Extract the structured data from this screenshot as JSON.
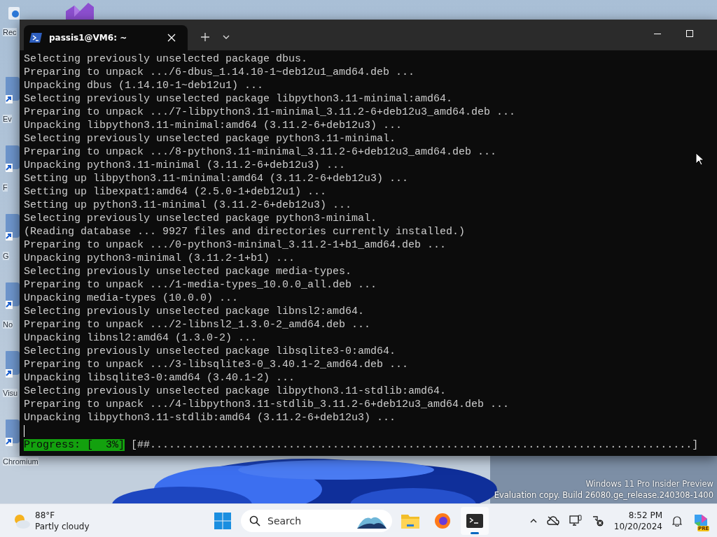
{
  "desktop_icons": [
    {
      "label": "Rec"
    },
    {
      "label": "Ev"
    },
    {
      "label": "F"
    },
    {
      "label": "G"
    },
    {
      "label": "No"
    },
    {
      "label": "Visu"
    },
    {
      "label": "Chromium"
    }
  ],
  "window": {
    "tab_title": "passis1@VM6: ~",
    "lines": [
      "Selecting previously unselected package dbus.",
      "Preparing to unpack .../6-dbus_1.14.10-1~deb12u1_amd64.deb ...",
      "Unpacking dbus (1.14.10-1~deb12u1) ...",
      "Selecting previously unselected package libpython3.11-minimal:amd64.",
      "Preparing to unpack .../7-libpython3.11-minimal_3.11.2-6+deb12u3_amd64.deb ...",
      "Unpacking libpython3.11-minimal:amd64 (3.11.2-6+deb12u3) ...",
      "Selecting previously unselected package python3.11-minimal.",
      "Preparing to unpack .../8-python3.11-minimal_3.11.2-6+deb12u3_amd64.deb ...",
      "Unpacking python3.11-minimal (3.11.2-6+deb12u3) ...",
      "Setting up libpython3.11-minimal:amd64 (3.11.2-6+deb12u3) ...",
      "Setting up libexpat1:amd64 (2.5.0-1+deb12u1) ...",
      "Setting up python3.11-minimal (3.11.2-6+deb12u3) ...",
      "Selecting previously unselected package python3-minimal.",
      "(Reading database ... 9927 files and directories currently installed.)",
      "Preparing to unpack .../0-python3-minimal_3.11.2-1+b1_amd64.deb ...",
      "Unpacking python3-minimal (3.11.2-1+b1) ...",
      "Selecting previously unselected package media-types.",
      "Preparing to unpack .../1-media-types_10.0.0_all.deb ...",
      "Unpacking media-types (10.0.0) ...",
      "Selecting previously unselected package libnsl2:amd64.",
      "Preparing to unpack .../2-libnsl2_1.3.0-2_amd64.deb ...",
      "Unpacking libnsl2:amd64 (1.3.0-2) ...",
      "Selecting previously unselected package libsqlite3-0:amd64.",
      "Preparing to unpack .../3-libsqlite3-0_3.40.1-2_amd64.deb ...",
      "Unpacking libsqlite3-0:amd64 (3.40.1-2) ...",
      "Selecting previously unselected package libpython3.11-stdlib:amd64.",
      "Preparing to unpack .../4-libpython3.11-stdlib_3.11.2-6+deb12u3_amd64.deb ...",
      "Unpacking libpython3.11-stdlib:amd64 (3.11.2-6+deb12u3) ..."
    ],
    "progress": {
      "label": "Progress: [  3%]",
      "bar": "[##......................................................................................]"
    }
  },
  "watermark": [
    "Windows 11 Pro Insider Preview",
    "Evaluation copy. Build 26080.ge_release.240308-1400"
  ],
  "taskbar": {
    "weather": {
      "temperature": "88°F",
      "condition": "Partly cloudy"
    },
    "search": {
      "placeholder": "Search"
    },
    "time": "8:52 PM",
    "date": "10/20/2024",
    "app_badge": "PRE"
  }
}
